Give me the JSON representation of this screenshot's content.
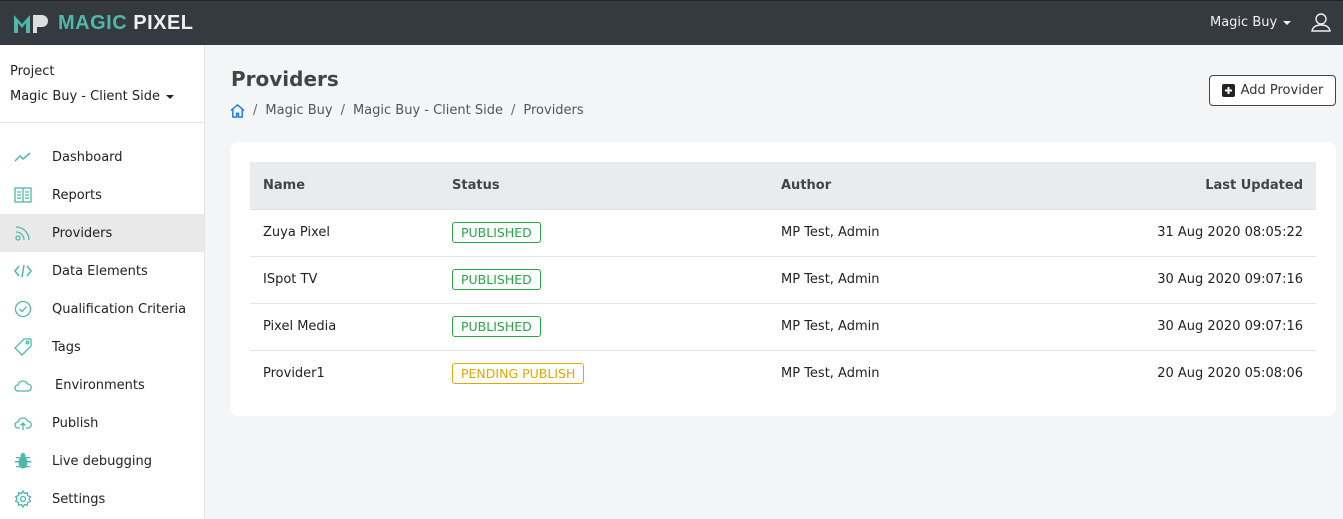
{
  "header": {
    "logo": "MAGIC PIXEL",
    "logo_a": "MAGIC",
    "logo_b": "PIXEL",
    "account": "Magic Buy"
  },
  "sidebar": {
    "project_label": "Project",
    "project_value": "Magic Buy - Client Side",
    "items": [
      {
        "label": "Dashboard",
        "icon": "chart-line-icon"
      },
      {
        "label": "Reports",
        "icon": "book-icon"
      },
      {
        "label": "Providers",
        "icon": "rss-icon",
        "active": true
      },
      {
        "label": "Data Elements",
        "icon": "code-icon"
      },
      {
        "label": "Qualification Criteria",
        "icon": "check-circle-icon"
      },
      {
        "label": "Tags",
        "icon": "tag-icon"
      },
      {
        "label": "Environments",
        "icon": "cloud-icon"
      },
      {
        "label": "Publish",
        "icon": "cloud-upload-icon"
      },
      {
        "label": "Live debugging",
        "icon": "bug-icon"
      },
      {
        "label": "Settings",
        "icon": "gear-icon"
      }
    ]
  },
  "page": {
    "title": "Providers",
    "add_button": "Add Provider",
    "breadcrumb": [
      "Magic Buy",
      "Magic Buy - Client Side",
      "Providers"
    ]
  },
  "table": {
    "headers": [
      "Name",
      "Status",
      "Author",
      "Last Updated"
    ],
    "rows": [
      {
        "name": "Zuya Pixel",
        "status": "PUBLISHED",
        "author": "MP Test, Admin",
        "updated": "31 Aug 2020 08:05:22"
      },
      {
        "name": "ISpot TV",
        "status": "PUBLISHED",
        "author": "MP Test, Admin",
        "updated": "30 Aug 2020 09:07:16"
      },
      {
        "name": "Pixel Media",
        "status": "PUBLISHED",
        "author": "MP Test, Admin",
        "updated": "30 Aug 2020 09:07:16"
      },
      {
        "name": "Provider1",
        "status": "PENDING PUBLISH",
        "author": "MP Test, Admin",
        "updated": "20 Aug 2020 05:08:06"
      }
    ]
  },
  "colors": {
    "accent": "#4fb8a8",
    "topbar": "#343a40",
    "published": "#28a745",
    "pending": "#e0a800"
  }
}
